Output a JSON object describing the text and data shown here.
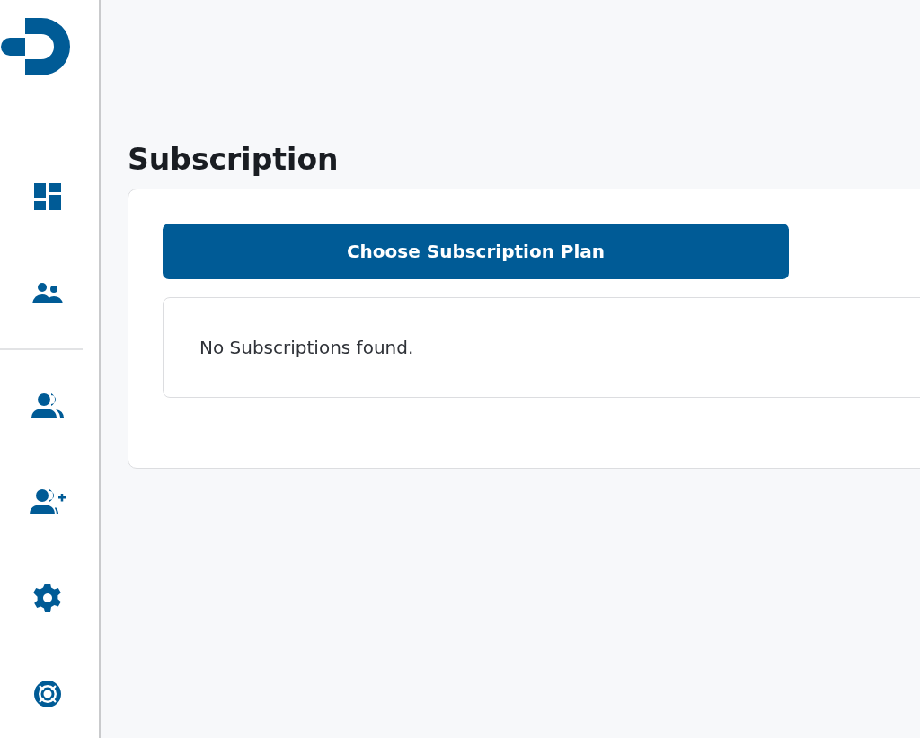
{
  "sidebar": {
    "nav_groups": [
      [
        {
          "kind": "dashboard"
        },
        {
          "kind": "team"
        }
      ],
      [
        {
          "kind": "users"
        },
        {
          "kind": "add-user"
        },
        {
          "kind": "settings"
        },
        {
          "kind": "support"
        }
      ]
    ]
  },
  "page": {
    "title": "Subscription",
    "primary_button": "Choose Subscription Plan",
    "empty_message": "No Subscriptions found."
  }
}
